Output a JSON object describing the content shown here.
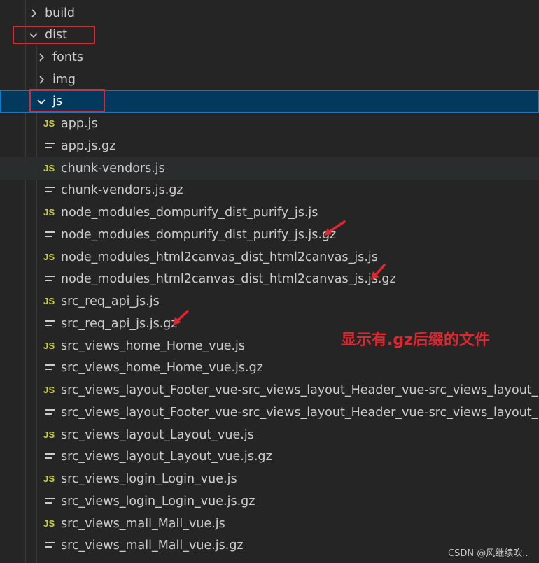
{
  "explorer": {
    "folders": {
      "build": "build",
      "dist": "dist",
      "fonts": "fonts",
      "img": "img",
      "js": "js"
    },
    "files": [
      {
        "name": "app.js",
        "type": "js"
      },
      {
        "name": "app.js.gz",
        "type": "gz"
      },
      {
        "name": "chunk-vendors.js",
        "type": "js"
      },
      {
        "name": "chunk-vendors.js.gz",
        "type": "gz"
      },
      {
        "name": "node_modules_dompurify_dist_purify_js.js",
        "type": "js"
      },
      {
        "name": "node_modules_dompurify_dist_purify_js.js.gz",
        "type": "gz"
      },
      {
        "name": "node_modules_html2canvas_dist_html2canvas_js.js",
        "type": "js"
      },
      {
        "name": "node_modules_html2canvas_dist_html2canvas_js.js.gz",
        "type": "gz"
      },
      {
        "name": "src_req_api_js.js",
        "type": "js"
      },
      {
        "name": "src_req_api_js.js.gz",
        "type": "gz"
      },
      {
        "name": "src_views_home_Home_vue.js",
        "type": "js"
      },
      {
        "name": "src_views_home_Home_vue.js.gz",
        "type": "gz"
      },
      {
        "name": "src_views_layout_Footer_vue-src_views_layout_Header_vue-src_views_layout_Right..",
        "type": "js"
      },
      {
        "name": "src_views_layout_Footer_vue-src_views_layout_Header_vue-src_views_layout_Right..",
        "type": "gz"
      },
      {
        "name": "src_views_layout_Layout_vue.js",
        "type": "js"
      },
      {
        "name": "src_views_layout_Layout_vue.js.gz",
        "type": "gz"
      },
      {
        "name": "src_views_login_Login_vue.js",
        "type": "js"
      },
      {
        "name": "src_views_login_Login_vue.js.gz",
        "type": "gz"
      },
      {
        "name": "src_views_mall_Mall_vue.js",
        "type": "js"
      },
      {
        "name": "src_views_mall_Mall_vue.js.gz",
        "type": "gz"
      }
    ],
    "js_badge": "JS"
  },
  "annotation": {
    "text": "显示有.gz后缀的文件",
    "color": "#e0262f"
  },
  "watermark": "CSDN @风继续吹..",
  "colors": {
    "background": "#252526",
    "selected_bg": "#04395e",
    "selected_border": "#007fd4",
    "js_icon": "#cbcb41",
    "text": "#cccccc",
    "highlight_red": "#e0262f"
  }
}
